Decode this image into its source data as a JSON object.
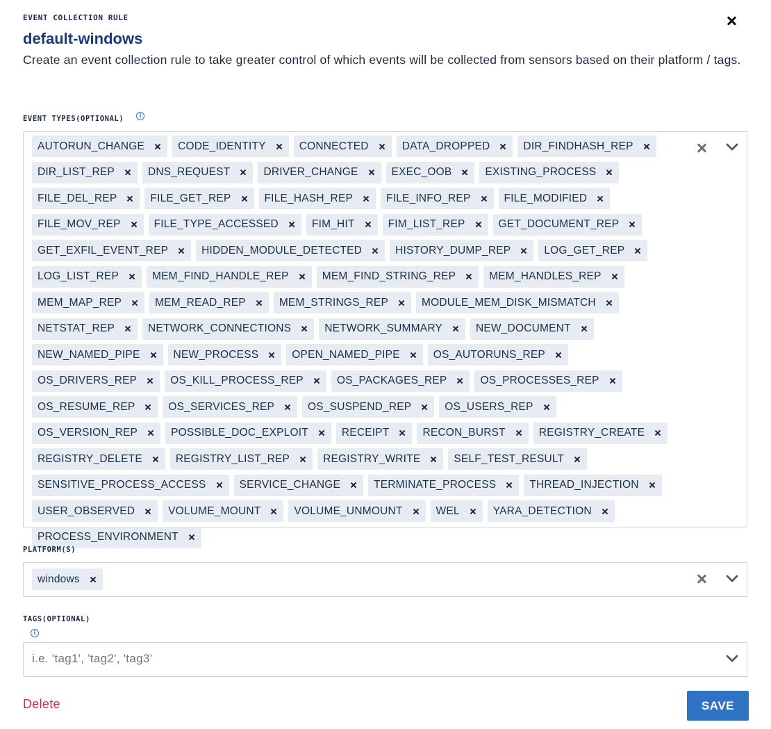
{
  "header": {
    "eyebrow": "EVENT COLLECTION RULE",
    "title": "default-windows",
    "description": "Create an event collection rule to take greater control of which events will be collected from sensors based on their platform / tags.",
    "close_icon": "close-icon"
  },
  "event_types": {
    "label": "EVENT TYPES(OPTIONAL)",
    "info_icon": "info-icon",
    "selected": [
      "AUTORUN_CHANGE",
      "CODE_IDENTITY",
      "CONNECTED",
      "DATA_DROPPED",
      "DIR_FINDHASH_REP",
      "DIR_LIST_REP",
      "DNS_REQUEST",
      "DRIVER_CHANGE",
      "EXEC_OOB",
      "EXISTING_PROCESS",
      "FILE_DEL_REP",
      "FILE_GET_REP",
      "FILE_HASH_REP",
      "FILE_INFO_REP",
      "FILE_MODIFIED",
      "FILE_MOV_REP",
      "FILE_TYPE_ACCESSED",
      "FIM_HIT",
      "FIM_LIST_REP",
      "GET_DOCUMENT_REP",
      "GET_EXFIL_EVENT_REP",
      "HIDDEN_MODULE_DETECTED",
      "HISTORY_DUMP_REP",
      "LOG_GET_REP",
      "LOG_LIST_REP",
      "MEM_FIND_HANDLE_REP",
      "MEM_FIND_STRING_REP",
      "MEM_HANDLES_REP",
      "MEM_MAP_REP",
      "MEM_READ_REP",
      "MEM_STRINGS_REP",
      "MODULE_MEM_DISK_MISMATCH",
      "NETSTAT_REP",
      "NETWORK_CONNECTIONS",
      "NETWORK_SUMMARY",
      "NEW_DOCUMENT",
      "NEW_NAMED_PIPE",
      "NEW_PROCESS",
      "OPEN_NAMED_PIPE",
      "OS_AUTORUNS_REP",
      "OS_DRIVERS_REP",
      "OS_KILL_PROCESS_REP",
      "OS_PACKAGES_REP",
      "OS_PROCESSES_REP",
      "OS_RESUME_REP",
      "OS_SERVICES_REP",
      "OS_SUSPEND_REP",
      "OS_USERS_REP",
      "OS_VERSION_REP",
      "POSSIBLE_DOC_EXPLOIT",
      "RECEIPT",
      "RECON_BURST",
      "REGISTRY_CREATE",
      "REGISTRY_DELETE",
      "REGISTRY_LIST_REP",
      "REGISTRY_WRITE",
      "SELF_TEST_RESULT",
      "SENSITIVE_PROCESS_ACCESS",
      "SERVICE_CHANGE",
      "TERMINATE_PROCESS",
      "THREAD_INJECTION",
      "USER_OBSERVED",
      "VOLUME_MOUNT",
      "VOLUME_UNMOUNT",
      "WEL",
      "YARA_DETECTION",
      "PROCESS_ENVIRONMENT"
    ]
  },
  "platforms": {
    "label": "PLATFORM(S)",
    "selected": [
      "windows"
    ]
  },
  "tags": {
    "label": "TAGS(OPTIONAL)",
    "info_icon": "info-icon",
    "placeholder": "i.e. 'tag1', 'tag2', 'tag3'"
  },
  "footer": {
    "delete_label": "Delete",
    "save_label": "SAVE"
  },
  "colors": {
    "title": "#1b3a73",
    "chip_bg": "#e7ecf3",
    "save_bg": "#2f73c4",
    "delete": "#d1284f",
    "info": "#2f6fd0"
  }
}
